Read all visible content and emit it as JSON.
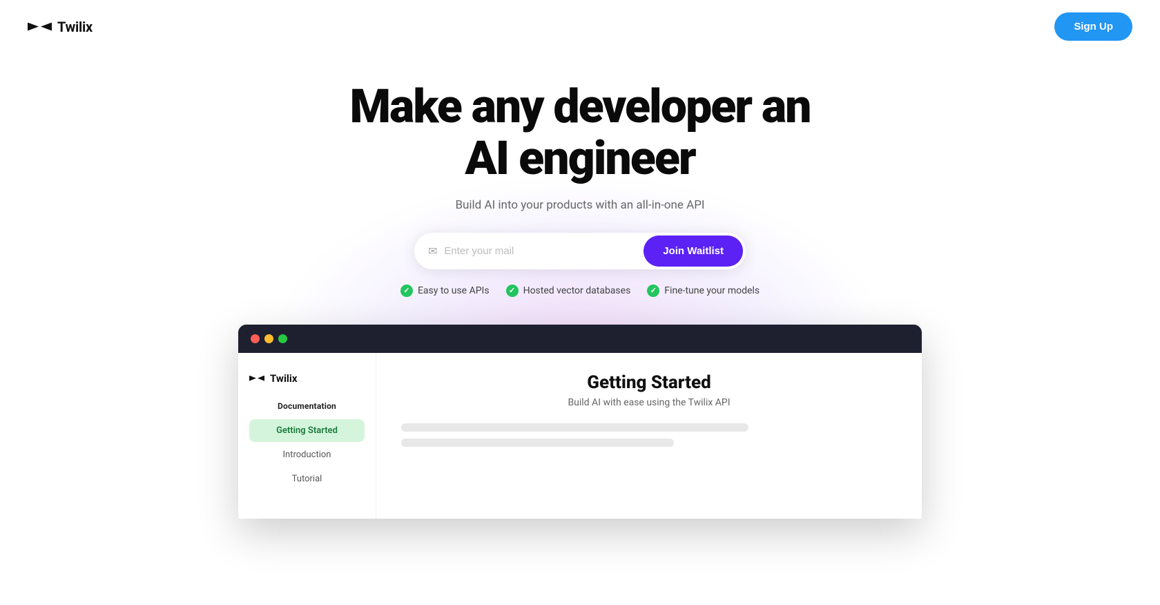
{
  "navbar": {
    "logo_text": "Twilix",
    "signup_label": "Sign Up"
  },
  "hero": {
    "title_line1": "Make any developer an",
    "title_line2": "AI engineer",
    "subtitle": "Build AI into your products with an all-in-one API",
    "email_placeholder": "Enter your mail",
    "join_label": "Join Waitlist",
    "features": [
      {
        "id": "f1",
        "label": "Easy to use APIs"
      },
      {
        "id": "f2",
        "label": "Hosted vector databases"
      },
      {
        "id": "f3",
        "label": "Fine-tune your models"
      }
    ]
  },
  "mockup": {
    "sidebar_logo": "Twilix",
    "doc_section": "Documentation",
    "nav_items": [
      {
        "id": "getting-started",
        "label": "Getting Started",
        "active": true
      },
      {
        "id": "introduction",
        "label": "Introduction",
        "active": false
      },
      {
        "id": "tutorial",
        "label": "Tutorial",
        "active": false
      }
    ],
    "doc_title": "Getting Started",
    "doc_subtitle": "Build AI with ease using the Twilix API"
  },
  "colors": {
    "signup_btn": "#2196F3",
    "join_btn": "#5B21F5",
    "active_nav_bg": "#d4f5dc",
    "active_nav_text": "#1a7a3a",
    "check": "#22c55e"
  }
}
